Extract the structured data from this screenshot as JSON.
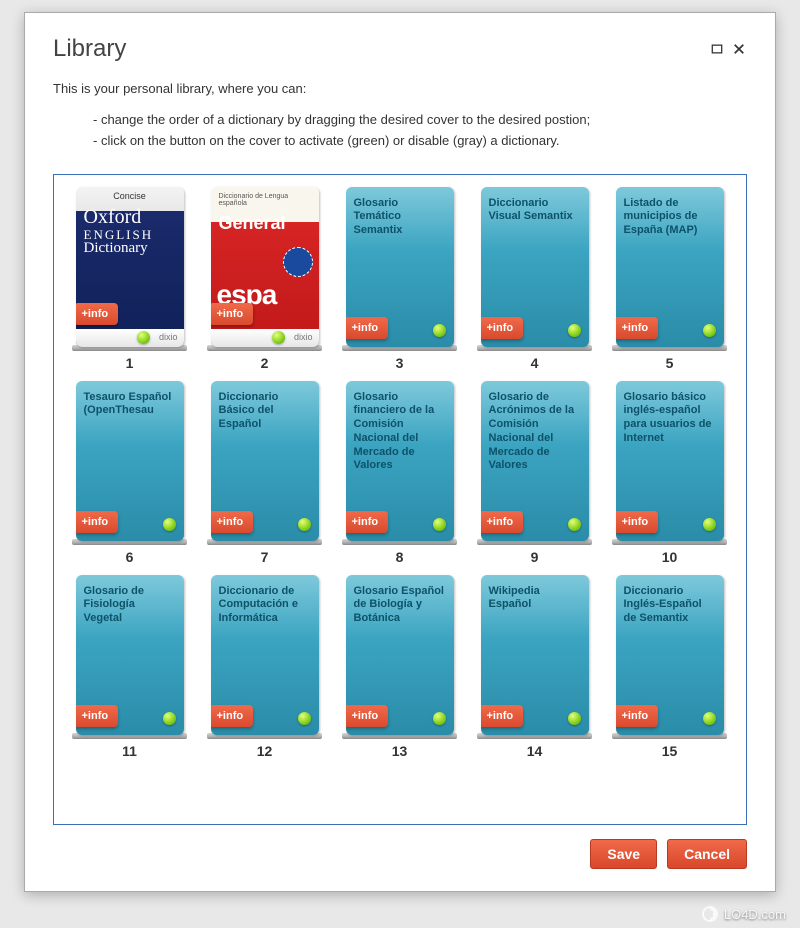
{
  "dialog": {
    "title": "Library",
    "intro": "This is your personal library, where you can:",
    "instruction1": "- change the order of a dictionary by dragging the desired cover to the desired postion;",
    "instruction2": "- click on the button on the cover to activate (green) or disable (gray) a dictionary.",
    "save_label": "Save",
    "cancel_label": "Cancel"
  },
  "info_label": "+info",
  "dixio_label": "dixio",
  "books": [
    {
      "num": "1",
      "kind": "oxford",
      "title": "Concise Oxford ENGLISH Dictionary",
      "active": true
    },
    {
      "num": "2",
      "kind": "general",
      "title": "General",
      "subtitle": "español",
      "active": true
    },
    {
      "num": "3",
      "kind": "teal",
      "title": "Glosario Temático Semantix",
      "active": true
    },
    {
      "num": "4",
      "kind": "teal",
      "title": "Diccionario Visual Semantix",
      "active": true
    },
    {
      "num": "5",
      "kind": "teal",
      "title": "Listado de municipios de España (MAP)",
      "active": true
    },
    {
      "num": "6",
      "kind": "teal",
      "title": "Tesauro Español (OpenThesau",
      "active": true
    },
    {
      "num": "7",
      "kind": "teal",
      "title": "Diccionario Básico del Español",
      "active": true
    },
    {
      "num": "8",
      "kind": "teal",
      "title": "Glosario financiero de la Comisión Nacional del Mercado de Valores",
      "active": true
    },
    {
      "num": "9",
      "kind": "teal",
      "title": "Glosario de Acrónimos de la Comisión Nacional del Mercado de Valores",
      "active": true
    },
    {
      "num": "10",
      "kind": "teal",
      "title": "Glosario básico inglés-español para usuarios de Internet",
      "active": true
    },
    {
      "num": "11",
      "kind": "teal",
      "title": "Glosario de Fisiología Vegetal",
      "active": true
    },
    {
      "num": "12",
      "kind": "teal",
      "title": "Diccionario de Computación e Informática",
      "active": true
    },
    {
      "num": "13",
      "kind": "teal",
      "title": "Glosario Español de Biología y Botánica",
      "active": true
    },
    {
      "num": "14",
      "kind": "teal",
      "title": "Wikipedia Español",
      "active": true
    },
    {
      "num": "15",
      "kind": "teal",
      "title": "Diccionario Inglés-Español de Semantix",
      "active": true
    }
  ],
  "watermark": "LO4D.com"
}
